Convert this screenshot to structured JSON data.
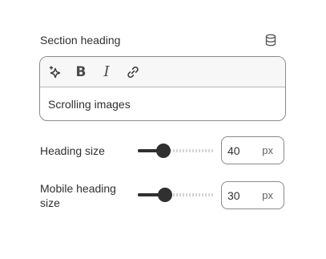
{
  "section": {
    "label": "Section heading",
    "dynamic_source_icon": "database-icon"
  },
  "editor": {
    "toolbar": {
      "ai_icon": "sparkle-icon",
      "bold_label": "B",
      "italic_label": "I",
      "link_icon": "link-icon"
    },
    "content": "Scrolling images"
  },
  "heading_size": {
    "label": "Heading size",
    "value": "40",
    "unit": "px",
    "slider_fraction": 0.33
  },
  "mobile_heading_size": {
    "label_line1": "Mobile heading",
    "label_line2": "size",
    "value": "30",
    "unit": "px",
    "slider_fraction": 0.35
  },
  "colors": {
    "text": "#303030",
    "border": "#8a8a8a",
    "slider_fill": "#303030",
    "toolbar_bg": "#f7f7f7"
  }
}
